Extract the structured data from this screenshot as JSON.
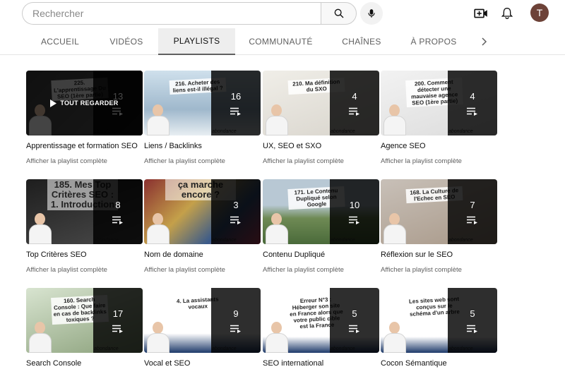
{
  "search": {
    "placeholder": "Rechercher"
  },
  "user": {
    "avatar_letter": "T"
  },
  "tabs": [
    {
      "label": "ACCUEIL"
    },
    {
      "label": "VIDÉOS"
    },
    {
      "label": "PLAYLISTS"
    },
    {
      "label": "COMMUNAUTÉ"
    },
    {
      "label": "CHAÎNES"
    },
    {
      "label": "À PROPOS"
    }
  ],
  "active_tab": "PLAYLISTS",
  "playlist_link_label": "Afficher la playlist complète",
  "play_all_label": "TOUT REGARDER",
  "brand_text": "abondance",
  "playlists": [
    {
      "title": "Apprentissage et formation SEO",
      "count": "13",
      "thumb_text": "225. L'apprentissage Du SEO (1ère partie)"
    },
    {
      "title": "Liens / Backlinks",
      "count": "16",
      "thumb_text": "216. Acheter des liens est-il illégal ?"
    },
    {
      "title": "UX, SEO et SXO",
      "count": "4",
      "thumb_text": "210. Ma définition du SXO"
    },
    {
      "title": "Agence SEO",
      "count": "4",
      "thumb_text": "200. Comment détecter une mauvaise agence SEO (1ère partie)"
    },
    {
      "title": "Top Critères SEO",
      "count": "8",
      "thumb_text": "185. Mes Top Critères SEO : 1. Introduction"
    },
    {
      "title": "Nom de domaine",
      "count": "3",
      "thumb_text": "ça marche encore ?"
    },
    {
      "title": "Contenu Dupliqué",
      "count": "10",
      "thumb_text": "171. Le Contenu Dupliqué selon Google"
    },
    {
      "title": "Réflexion sur le SEO",
      "count": "7",
      "thumb_text": "168. La Culture de l'Echec en SEO"
    },
    {
      "title": "Search Console",
      "count": "17",
      "thumb_text": "160. Search Console : Que faire en cas de backlinks toxiques ?"
    },
    {
      "title": "Vocal et SEO",
      "count": "9",
      "thumb_text": "4. La assistants vocaux"
    },
    {
      "title": "SEO international",
      "count": "5",
      "thumb_text": "Erreur N°3 : Héberger son site en France alors que votre public cible est la France"
    },
    {
      "title": "Cocon Sémantique",
      "count": "5",
      "thumb_text": "Les sites web sont conçus sur le schéma d'un arbre"
    }
  ],
  "colors": {
    "avatar_bg": "#6d4238",
    "active_tab_bg": "#eeeeee",
    "overlay": "#000000"
  }
}
